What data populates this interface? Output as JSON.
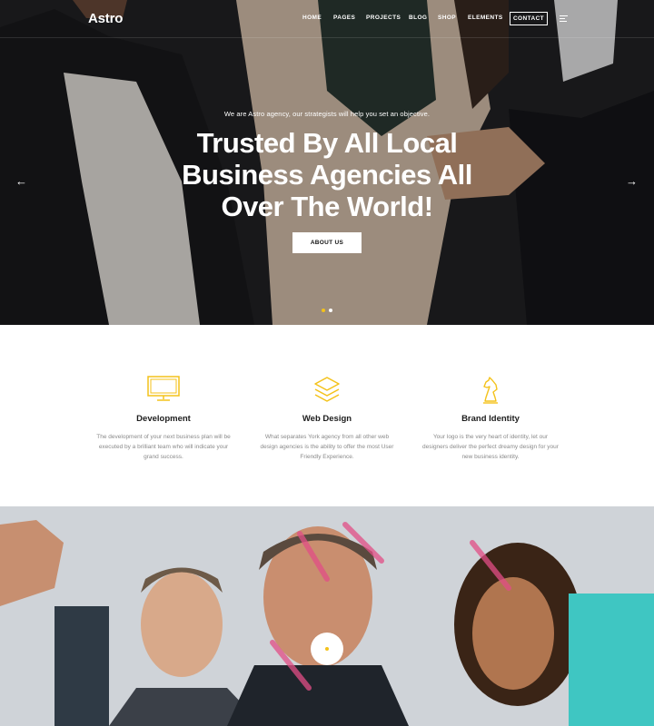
{
  "brand": {
    "logo": "Astro",
    "accent": "#f4c21a"
  },
  "nav": {
    "items": [
      {
        "label": "HOME"
      },
      {
        "label": "PAGES"
      },
      {
        "label": "PROJECTS"
      },
      {
        "label": "BLOG"
      },
      {
        "label": "SHOP"
      },
      {
        "label": "ELEMENTS"
      }
    ],
    "contact_label": "CONTACT",
    "menu_icon": "hamburger-icon"
  },
  "hero": {
    "subtitle": "We are Astro agency, our strategists will help you set an objective.",
    "title_lines": [
      "Trusted By All Local",
      "Business Agencies All",
      "Over The World!"
    ],
    "button_label": "ABOUT US",
    "prev_arrow": "←",
    "next_arrow": "→",
    "slides": 2,
    "active_slide": 1
  },
  "services": [
    {
      "icon": "monitor-icon",
      "title": "Development",
      "text": "The development of your next business plan will be executed by a brilliant team who will indicate your grand success."
    },
    {
      "icon": "layers-icon",
      "title": "Web Design",
      "text": "What separates York agency from all other web design agencies is the ability to offer the most User Friendly Experience."
    },
    {
      "icon": "chess-knight-icon",
      "title": "Brand Identity",
      "text": "Your logo is the very heart of identity, let our designers deliver the perfect dreamy design for your new business identity."
    }
  ],
  "video": {
    "play_icon": "play-icon"
  }
}
